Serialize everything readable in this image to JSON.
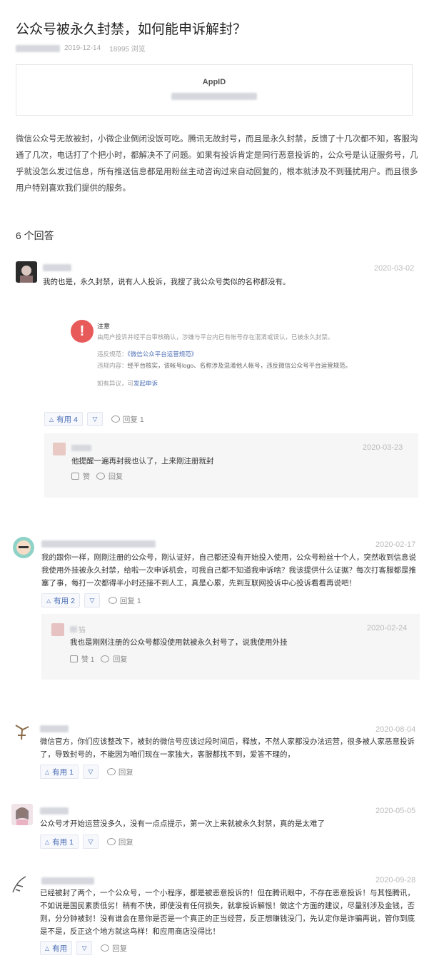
{
  "question": {
    "title": "公众号被永久封禁，如何能申诉解封？",
    "date": "2019-12-14",
    "views": "18995 浏览",
    "appid_label": "AppID",
    "description": "微信公众号无故被封，小微企业倒闭没饭可吃。腾讯无故封号，而且是永久封禁，反馈了十几次都不知，客服沟通了几次，电话打了个把小时，都解决不了问题。如果有投诉肯定是同行恶意投诉的，公众号是认证服务号，几乎就没怎么发过信息，所有推送信息都是用粉丝主动咨询过来自动回复的，根本就涉及不到骚扰用户。而且很多用户特别喜欢我们提供的服务。"
  },
  "answers_count": "6 个回答",
  "answers": [
    {
      "date": "2020-03-02",
      "text": "我的也是，永久封禁，说有人人投诉，我搜了我公众号类似的名称都没有。",
      "notice": {
        "heading": "注意",
        "text": "由用户投诉并经平台审核确认，涉嫌与平台内已有帐号存在混淆或误认，已被永久封禁。",
        "rule_label": "违反规范：",
        "rule_link": "《微信公众平台运营规范》",
        "content_label": "违规内容：",
        "content_text": "经平台核实，该帐号logo、名称涉及混淆他人帐号，违反微信公众号平台运营规范。",
        "appeal_text": "如有异议，可",
        "appeal_link": "发起申诉"
      },
      "like_label": "有用 4",
      "reply_label": "回复 1",
      "reply": {
        "date": "2020-03-23",
        "text": "他提醒一遍再封我也认了，上来刚注册就封",
        "like_label": "赞",
        "reply_label": "回复"
      }
    },
    {
      "date": "2020-02-17",
      "text": "我的跟你一样，刚刚注册的公众号，刚认证好，自己都还没有开始投入使用，公众号粉丝十个人，突然收到信息说我使用外挂被永久封禁，给啦一次申诉机会，可我自己都不知道我申诉啥？我该提供什么证据？每次打客服都是推塞了事，每打一次都得半小时还接不到人工，真是心累，先到互联网投诉中心投诉看看再说吧！",
      "like_label": "有用 2",
      "reply_label": "回复 1",
      "reply": {
        "name_suffix": "猫",
        "date": "2020-02-24",
        "text": "我也是刚刚注册的公众号都没使用就被永久封号了，说我使用外挂",
        "like_label": "赞 1",
        "reply_label": "回复"
      }
    },
    {
      "date": "2020-08-04",
      "text": "微信官方，你们应该整改下，被封的微信号应该过段时间后，释放，不然人家都没办法运营，很多被人家恶意投诉了，导致封号的，不能因为咱们现在一家独大，客服都找不到，爱答不理的，",
      "like_label": "有用 1",
      "reply_label": "回复"
    },
    {
      "date": "2020-05-05",
      "text": "公众号才开始运营没多久，没有一点点提示，第一次上来就被永久封禁，真的是太难了",
      "like_label": "有用 1",
      "reply_label": "回复"
    },
    {
      "date": "2020-09-28",
      "text": "已经被封了两个，一个公众号，一个小程序，都是被恶意投诉的！但在腾讯眼中，不存在恶意投诉！与其怪腾讯，不如说是国民素质低劣！稍有不快，即使没有任何损失，就拿投诉解恨！做这个方面的建议，尽量别涉及金钱，否则，分分钟被封！没有谁会在意你是否是一个真正的正当经营，反正想赚钱没门，先认定你是诈骗再说，管你到底是不是，反正这个地方就这鸟样！和应用商店没得比！",
      "like_label": "有用",
      "reply_label": "回复"
    }
  ]
}
